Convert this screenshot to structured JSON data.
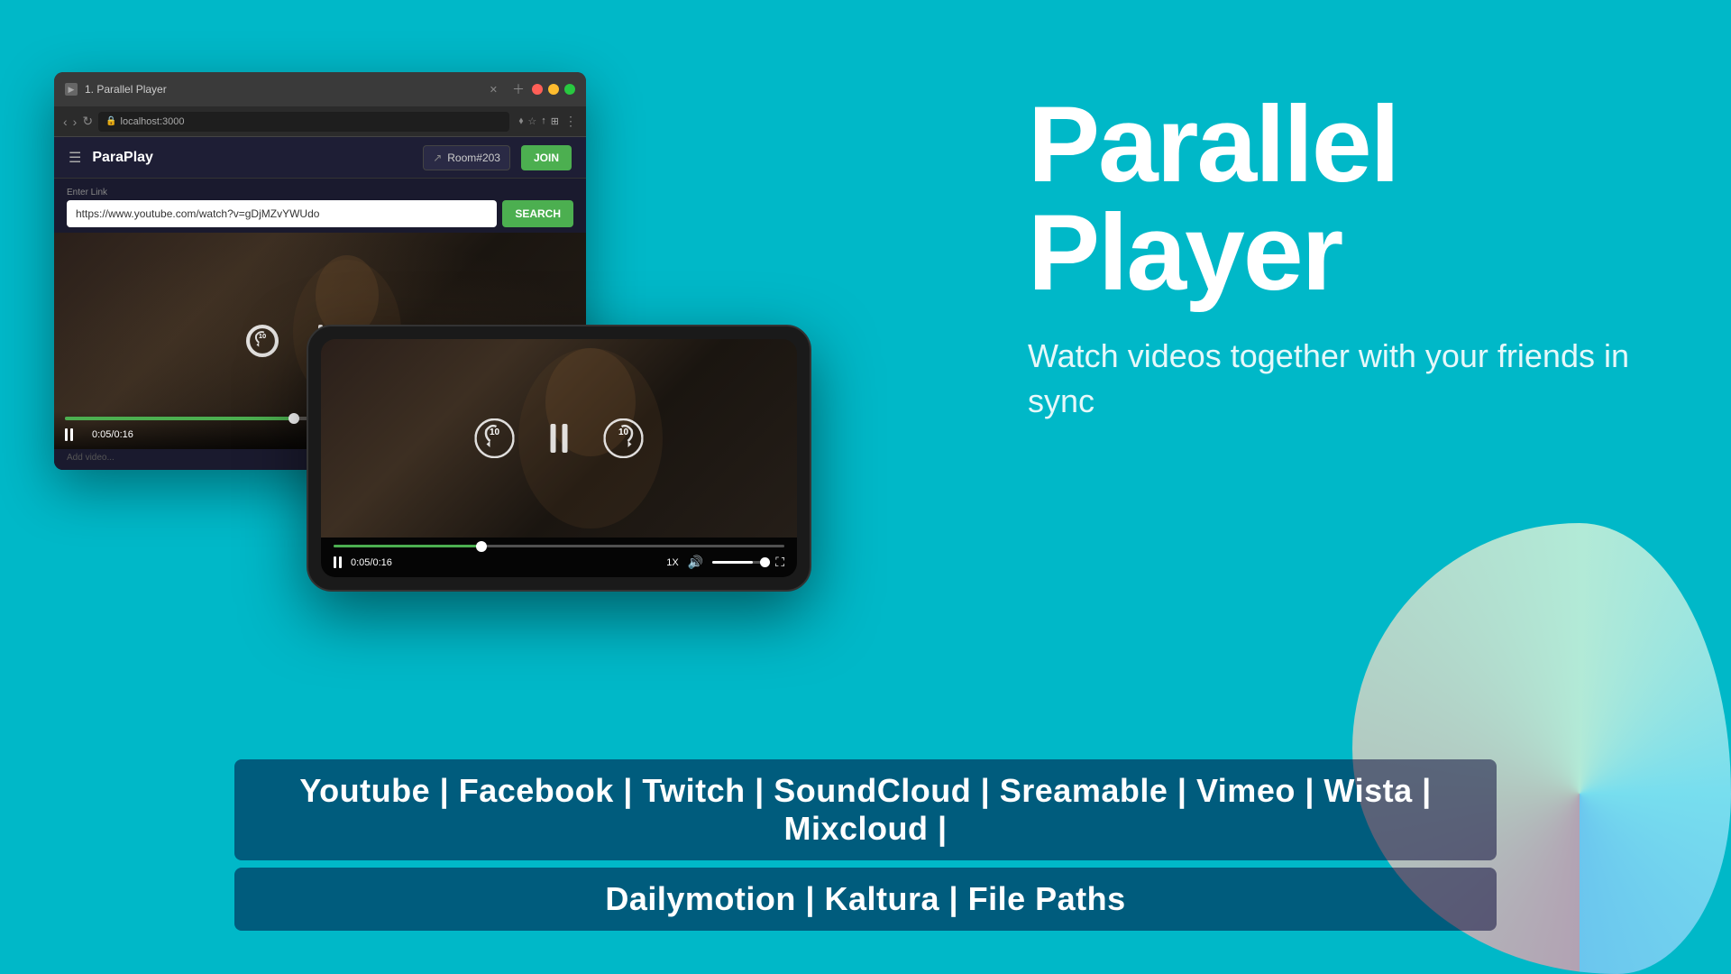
{
  "background": {
    "color": "#00b8c8"
  },
  "browser": {
    "tab_title": "1. Parallel Player",
    "url": "localhost:3000",
    "favicon": "▶"
  },
  "app": {
    "name": "ParaPlay",
    "room_input": "Room#203",
    "join_button": "JOIN",
    "enter_link_label": "Enter Link",
    "url_value": "https://www.youtube.com/watch?v=gDjMZvYWUdo",
    "search_button": "SEARCH",
    "time_current": "0:05",
    "time_total": "0:16",
    "add_video_hint": "Add video..."
  },
  "controls": {
    "rewind_seconds": "10",
    "forward_seconds": "10"
  },
  "phone": {
    "time_current": "0:05",
    "time_total": "0:16",
    "speed": "1X",
    "progress_percent": 33
  },
  "browser_progress_percent": 45,
  "main_title_line1": "Parallel",
  "main_title_line2": "Player",
  "subtitle": "Watch videos together with your friends in sync",
  "bottom_banner": {
    "line1": "Youtube | Facebook | Twitch | SoundCloud | Sreamable | Vimeo | Wista | Mixcloud |",
    "line2": "Dailymotion | Kaltura | File Paths"
  }
}
